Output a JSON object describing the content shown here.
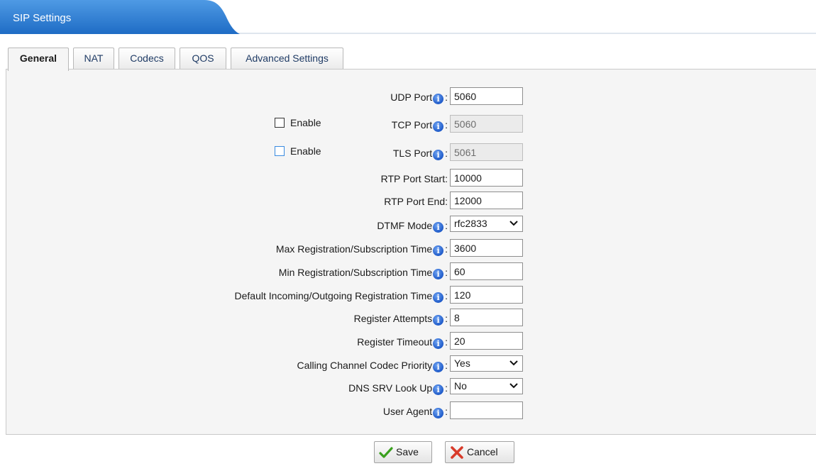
{
  "header": {
    "title": "SIP Settings"
  },
  "tabs": [
    {
      "label": "General",
      "active": true
    },
    {
      "label": "NAT"
    },
    {
      "label": "Codecs"
    },
    {
      "label": "QOS"
    },
    {
      "label": "Advanced Settings"
    }
  ],
  "form": {
    "udp_port": {
      "label": "UDP Port",
      "value": "5060"
    },
    "tcp_port": {
      "label": "TCP Port",
      "value": "5060",
      "enable_label": "Enable",
      "enabled": false
    },
    "tls_port": {
      "label": "TLS Port",
      "value": "5061",
      "enable_label": "Enable",
      "enabled": false
    },
    "rtp_start": {
      "label": "RTP Port Start:",
      "value": "10000"
    },
    "rtp_end": {
      "label": "RTP Port End:",
      "value": "12000"
    },
    "dtmf_mode": {
      "label": "DTMF Mode",
      "value": "rfc2833"
    },
    "max_reg": {
      "label": "Max Registration/Subscription Time",
      "value": "3600"
    },
    "min_reg": {
      "label": "Min Registration/Subscription Time",
      "value": "60"
    },
    "default_reg": {
      "label": "Default Incoming/Outgoing Registration Time",
      "value": "120"
    },
    "reg_attempts": {
      "label": "Register Attempts",
      "value": "8"
    },
    "reg_timeout": {
      "label": "Register Timeout",
      "value": "20"
    },
    "codec_priority": {
      "label": "Calling Channel Codec Priority",
      "value": "Yes"
    },
    "dns_srv": {
      "label": "DNS SRV Look Up",
      "value": "No"
    },
    "user_agent": {
      "label": "User Agent",
      "value": ""
    }
  },
  "buttons": {
    "save": "Save",
    "cancel": "Cancel"
  },
  "colors": {
    "header_blue": "#2d7dd2",
    "panel_bg": "#f5f5f5",
    "info_icon": "#2a63cf"
  },
  "icons": {
    "info": "info-icon",
    "save": "checkmark-icon",
    "cancel": "x-icon",
    "select": "chevron-down-icon"
  }
}
